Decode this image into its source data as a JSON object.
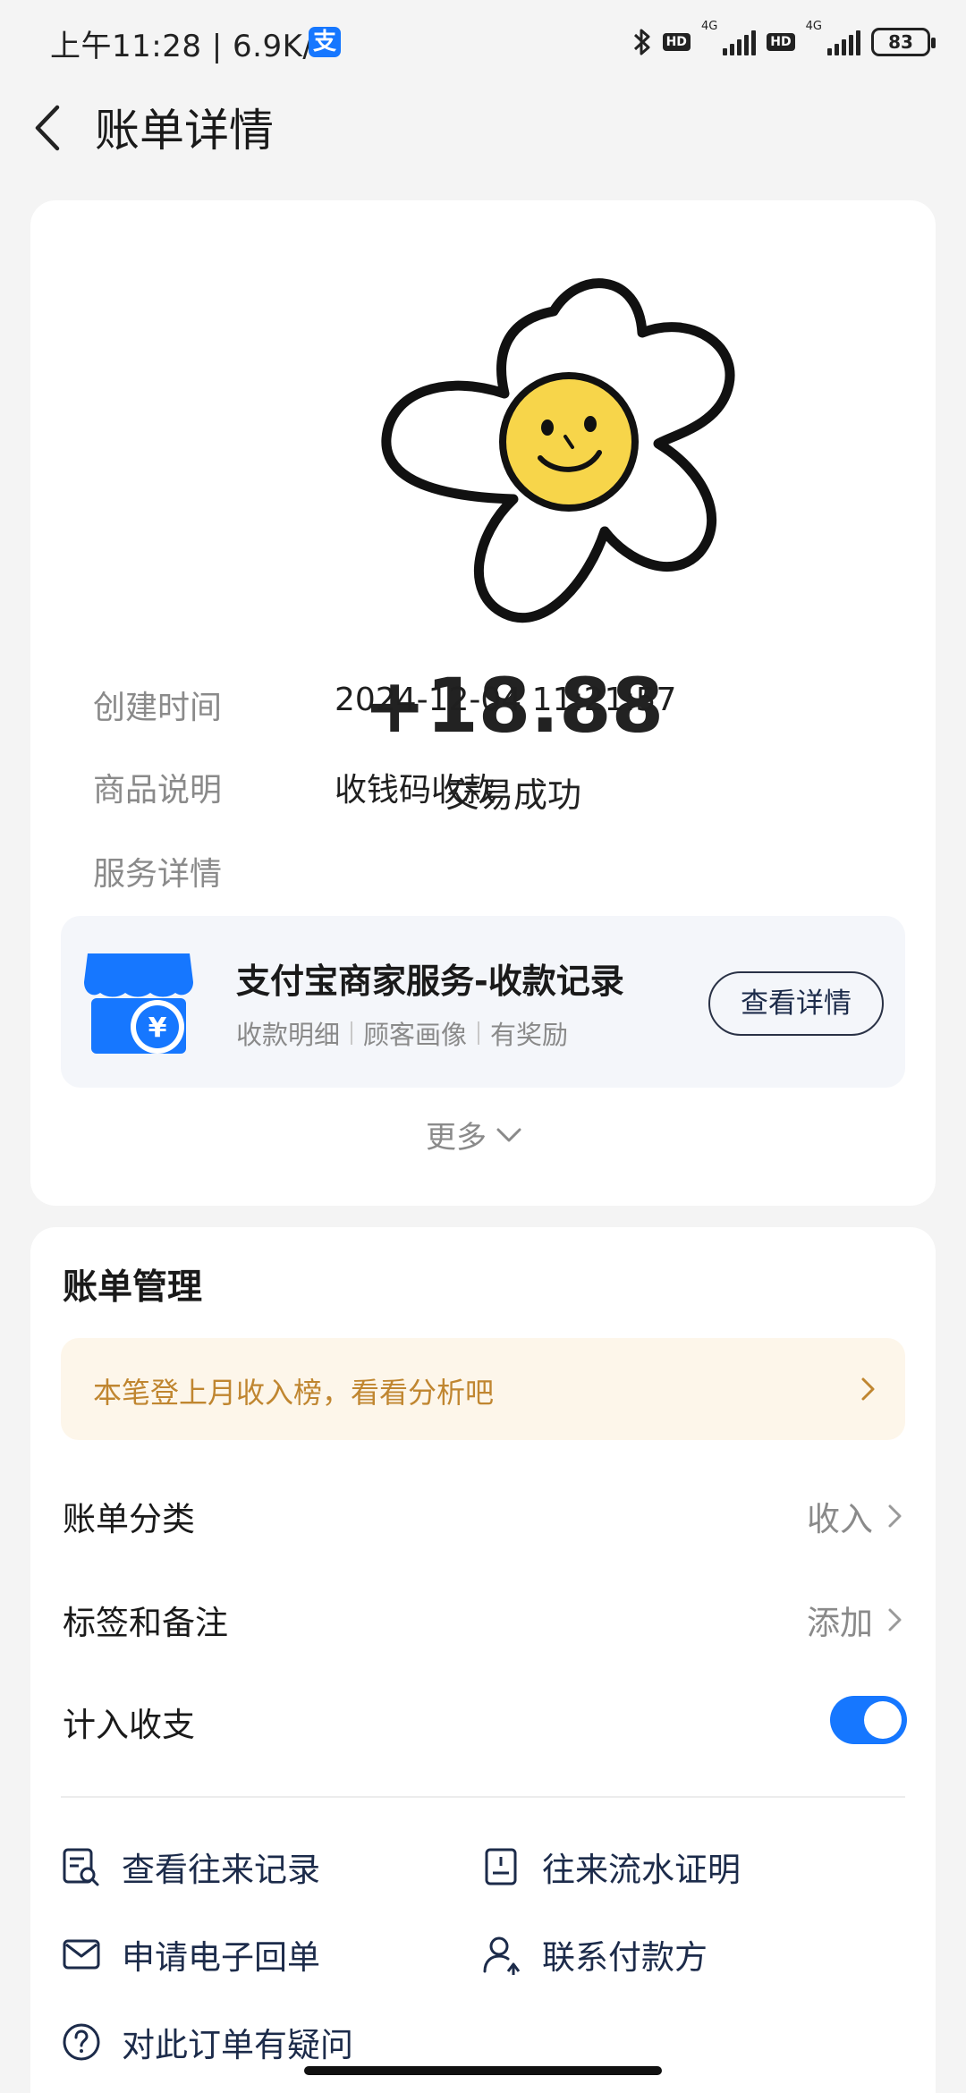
{
  "status_bar": {
    "time_speed": "上午11:28 | 6.9K/s",
    "app_badge": "支",
    "network_1": "4G",
    "network_2": "4G",
    "hd_label": "HD",
    "battery": "83"
  },
  "header": {
    "title": "账单详情"
  },
  "transaction": {
    "amount": "+18.88",
    "status": "交易成功",
    "fields": [
      {
        "label": "创建时间",
        "value": "2024-12-04 11:21:57"
      },
      {
        "label": "商品说明",
        "value": "收钱码收款"
      },
      {
        "label": "服务详情",
        "value": ""
      }
    ]
  },
  "service": {
    "title": "支付宝商家服务-收款记录",
    "tags": [
      "收款明细",
      "顾客画像",
      "有奖励"
    ],
    "button": "查看详情"
  },
  "more_label": "更多",
  "bill_management": {
    "title": "账单管理",
    "banner": "本笔登上月收入榜，看看分析吧",
    "rows": [
      {
        "label": "账单分类",
        "value": "收入"
      },
      {
        "label": "标签和备注",
        "value": "添加"
      },
      {
        "label": "计入收支",
        "toggle_on": true
      }
    ],
    "links": [
      {
        "label": "查看往来记录",
        "icon": "record-search-icon"
      },
      {
        "label": "往来流水证明",
        "icon": "document-icon"
      },
      {
        "label": "申请电子回单",
        "icon": "mail-icon"
      },
      {
        "label": "联系付款方",
        "icon": "contact-user-icon"
      },
      {
        "label": "对此订单有疑问",
        "icon": "question-icon"
      }
    ]
  },
  "colors": {
    "accent": "#1677ff",
    "banner_text": "#c08630",
    "banner_bg": "#fdf6ea",
    "flower_face": "#f7d54a"
  }
}
